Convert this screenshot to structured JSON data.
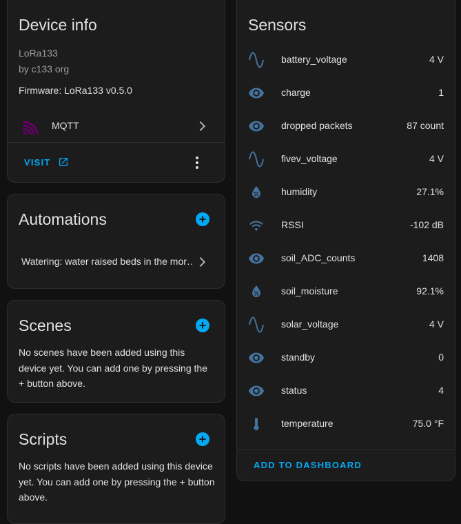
{
  "device_info": {
    "title": "Device info",
    "model": "LoRa133",
    "manufacturer": "by c133 org",
    "firmware": "Firmware: LoRa133 v0.5.0",
    "integration": "MQTT",
    "visit_label": "VISIT"
  },
  "automations": {
    "title": "Automations",
    "items": [
      "Watering: water raised beds in the mor…"
    ]
  },
  "scenes": {
    "title": "Scenes",
    "empty_text": "No scenes have been added using this device yet. You can add one by pressing the + button above."
  },
  "scripts": {
    "title": "Scripts",
    "empty_text": "No scripts have been added using this device yet. You can add one by pressing the + button above."
  },
  "sensors": {
    "title": "Sensors",
    "items": [
      {
        "icon": "sine-wave-icon",
        "name": "battery_voltage",
        "value": "4 V"
      },
      {
        "icon": "eye-icon",
        "name": "charge",
        "value": "1"
      },
      {
        "icon": "eye-icon",
        "name": "dropped packets",
        "value": "87 count"
      },
      {
        "icon": "sine-wave-icon",
        "name": "fivev_voltage",
        "value": "4 V"
      },
      {
        "icon": "water-percent-icon",
        "name": "humidity",
        "value": "27.1%"
      },
      {
        "icon": "wifi-icon",
        "name": "RSSI",
        "value": "-102 dB"
      },
      {
        "icon": "eye-icon",
        "name": "soil_ADC_counts",
        "value": "1408"
      },
      {
        "icon": "water-percent-icon",
        "name": "soil_moisture",
        "value": "92.1%"
      },
      {
        "icon": "sine-wave-icon",
        "name": "solar_voltage",
        "value": "4 V"
      },
      {
        "icon": "eye-icon",
        "name": "standby",
        "value": "0"
      },
      {
        "icon": "eye-icon",
        "name": "status",
        "value": "4"
      },
      {
        "icon": "thermometer-icon",
        "name": "temperature",
        "value": "75.0 °F"
      }
    ],
    "add_to_dashboard_label": "ADD TO DASHBOARD"
  },
  "colors": {
    "accent": "#03a9f4",
    "icon": "#44739e",
    "mqtt_logo": "#660066",
    "card_bg": "#1c1c1c",
    "page_bg": "#111111"
  }
}
